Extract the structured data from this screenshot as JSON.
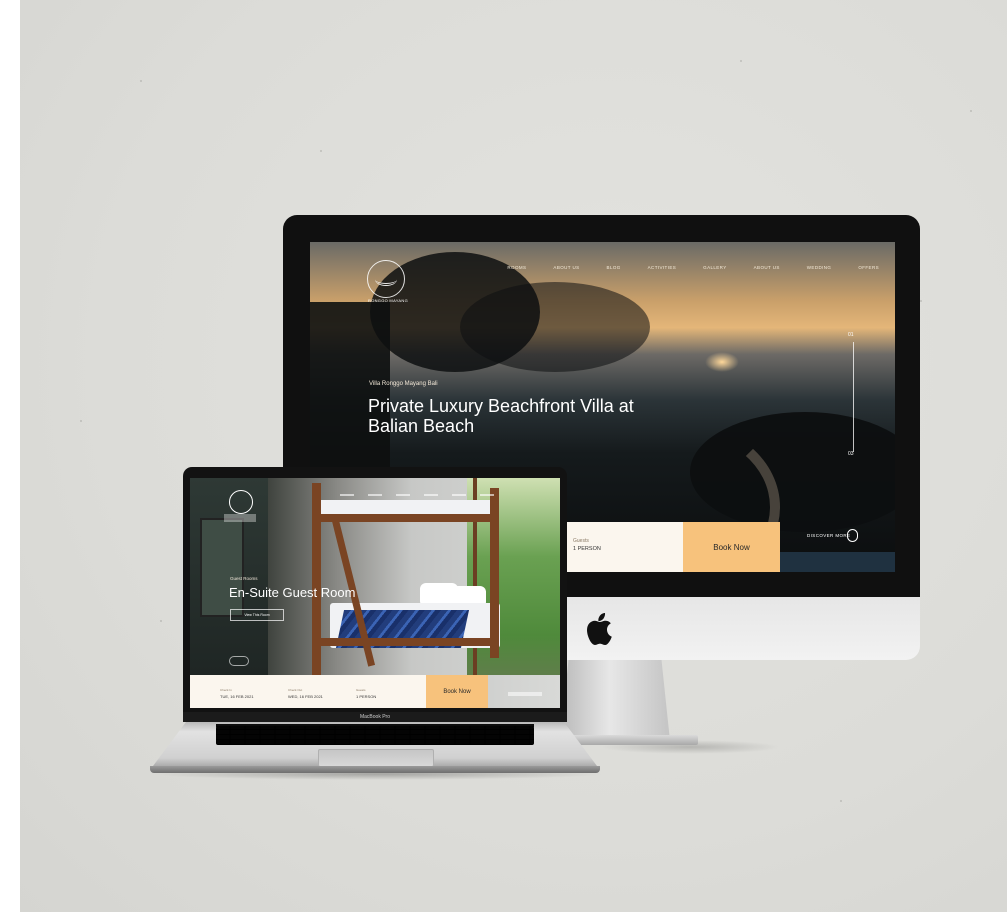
{
  "imac": {
    "logo_text": "RONGGO MAYANG",
    "nav": [
      "ROOMS",
      "ABOUT US",
      "BLOG",
      "ACTIVITIES",
      "GALLERY",
      "ABOUT US",
      "WEDDING",
      "OFFERS"
    ],
    "hero_subtitle": "Villa Ronggo Mayang Bali",
    "hero_title": "Private Luxury Beachfront Villa at Balian Beach",
    "scroll_top": "01",
    "scroll_bottom": "03",
    "guest_label": "Guests",
    "guest_value": "1 PERSON",
    "book_button": "Book Now",
    "discover": "DISCOVER MORE"
  },
  "macbook": {
    "tag": "Guest Rooms",
    "title": "En-Suite Guest Room",
    "view_link": "View This Room",
    "checkin_label": "Check In",
    "checkin_value": "TUE, 16 FEB 2021",
    "checkout_label": "Check Out",
    "checkout_value": "WED, 16 FEB 2021",
    "guests_label": "Guests",
    "guests_value": "1 PERSON",
    "book_button": "Book Now",
    "chin_label": "MacBook Pro"
  },
  "colors": {
    "book_accent": "#f7c27c",
    "booking_bar": "#fbf6ee",
    "navy": "#1f3140"
  }
}
